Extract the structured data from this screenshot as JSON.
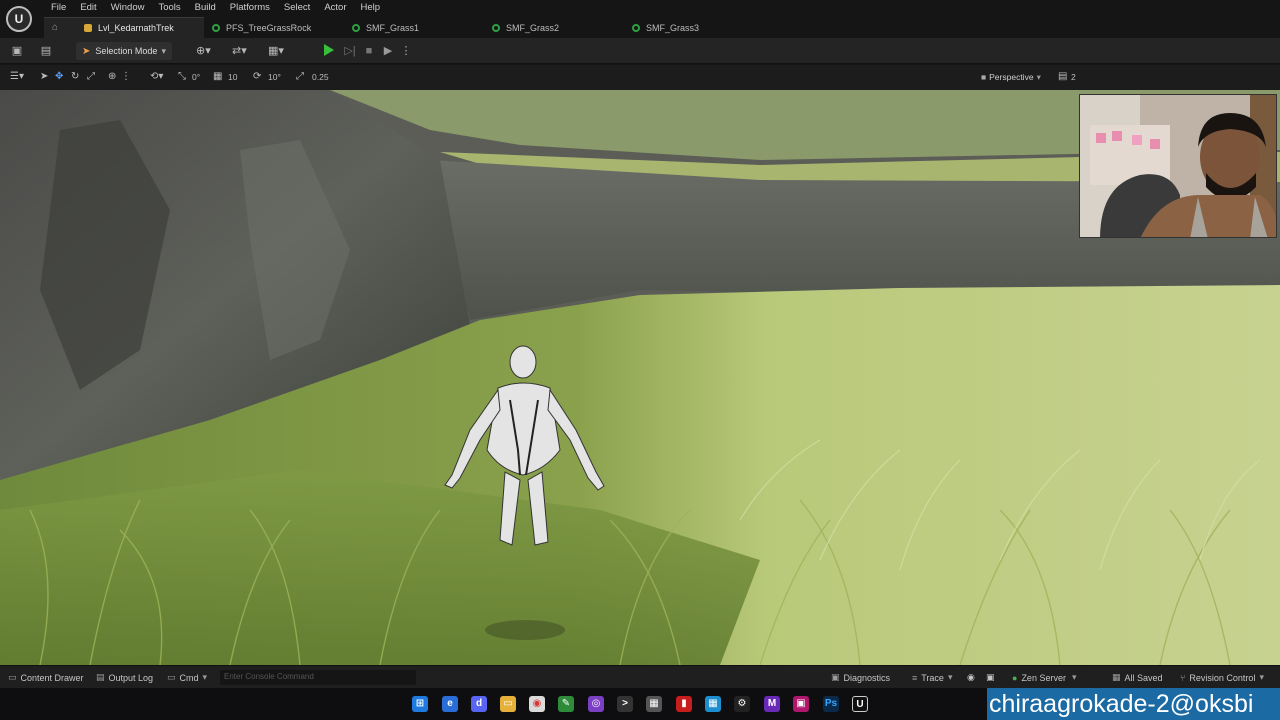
{
  "menu": [
    "File",
    "Edit",
    "Window",
    "Tools",
    "Build",
    "Platforms",
    "Select",
    "Actor",
    "Help"
  ],
  "tabs": [
    {
      "label": "Lvl_KedarnathTrek",
      "active": true
    },
    {
      "label": "PFS_TreeGrassRock",
      "active": false
    },
    {
      "label": "SMF_Grass1",
      "active": false
    },
    {
      "label": "SMF_Grass2",
      "active": false
    },
    {
      "label": "SMF_Grass3",
      "active": false
    }
  ],
  "toolbar": {
    "mode_label": "Selection Mode"
  },
  "viewport_toolbar": {
    "rotation_snap": "0°",
    "grid_snap": "10",
    "angle_snap": "10°",
    "scale_snap": "0.25",
    "view_mode": "Perspective",
    "extra": "2"
  },
  "statusbar": {
    "content_drawer": "Content Drawer",
    "output_log": "Output Log",
    "cmd": "Cmd",
    "console_placeholder": "Enter Console Command",
    "diagnostics": "Diagnostics",
    "trace": "Trace",
    "zen_server": "Zen Server",
    "all_saved": "All Saved",
    "revision_control": "Revision Control"
  },
  "watermark": "chiraagrokade-2@oksbi",
  "colors": {
    "accent_orange": "#f0a24a",
    "play_green": "#37c13a",
    "grass_green": "#2ea043",
    "watermark_bg": "#1b6aa3"
  }
}
